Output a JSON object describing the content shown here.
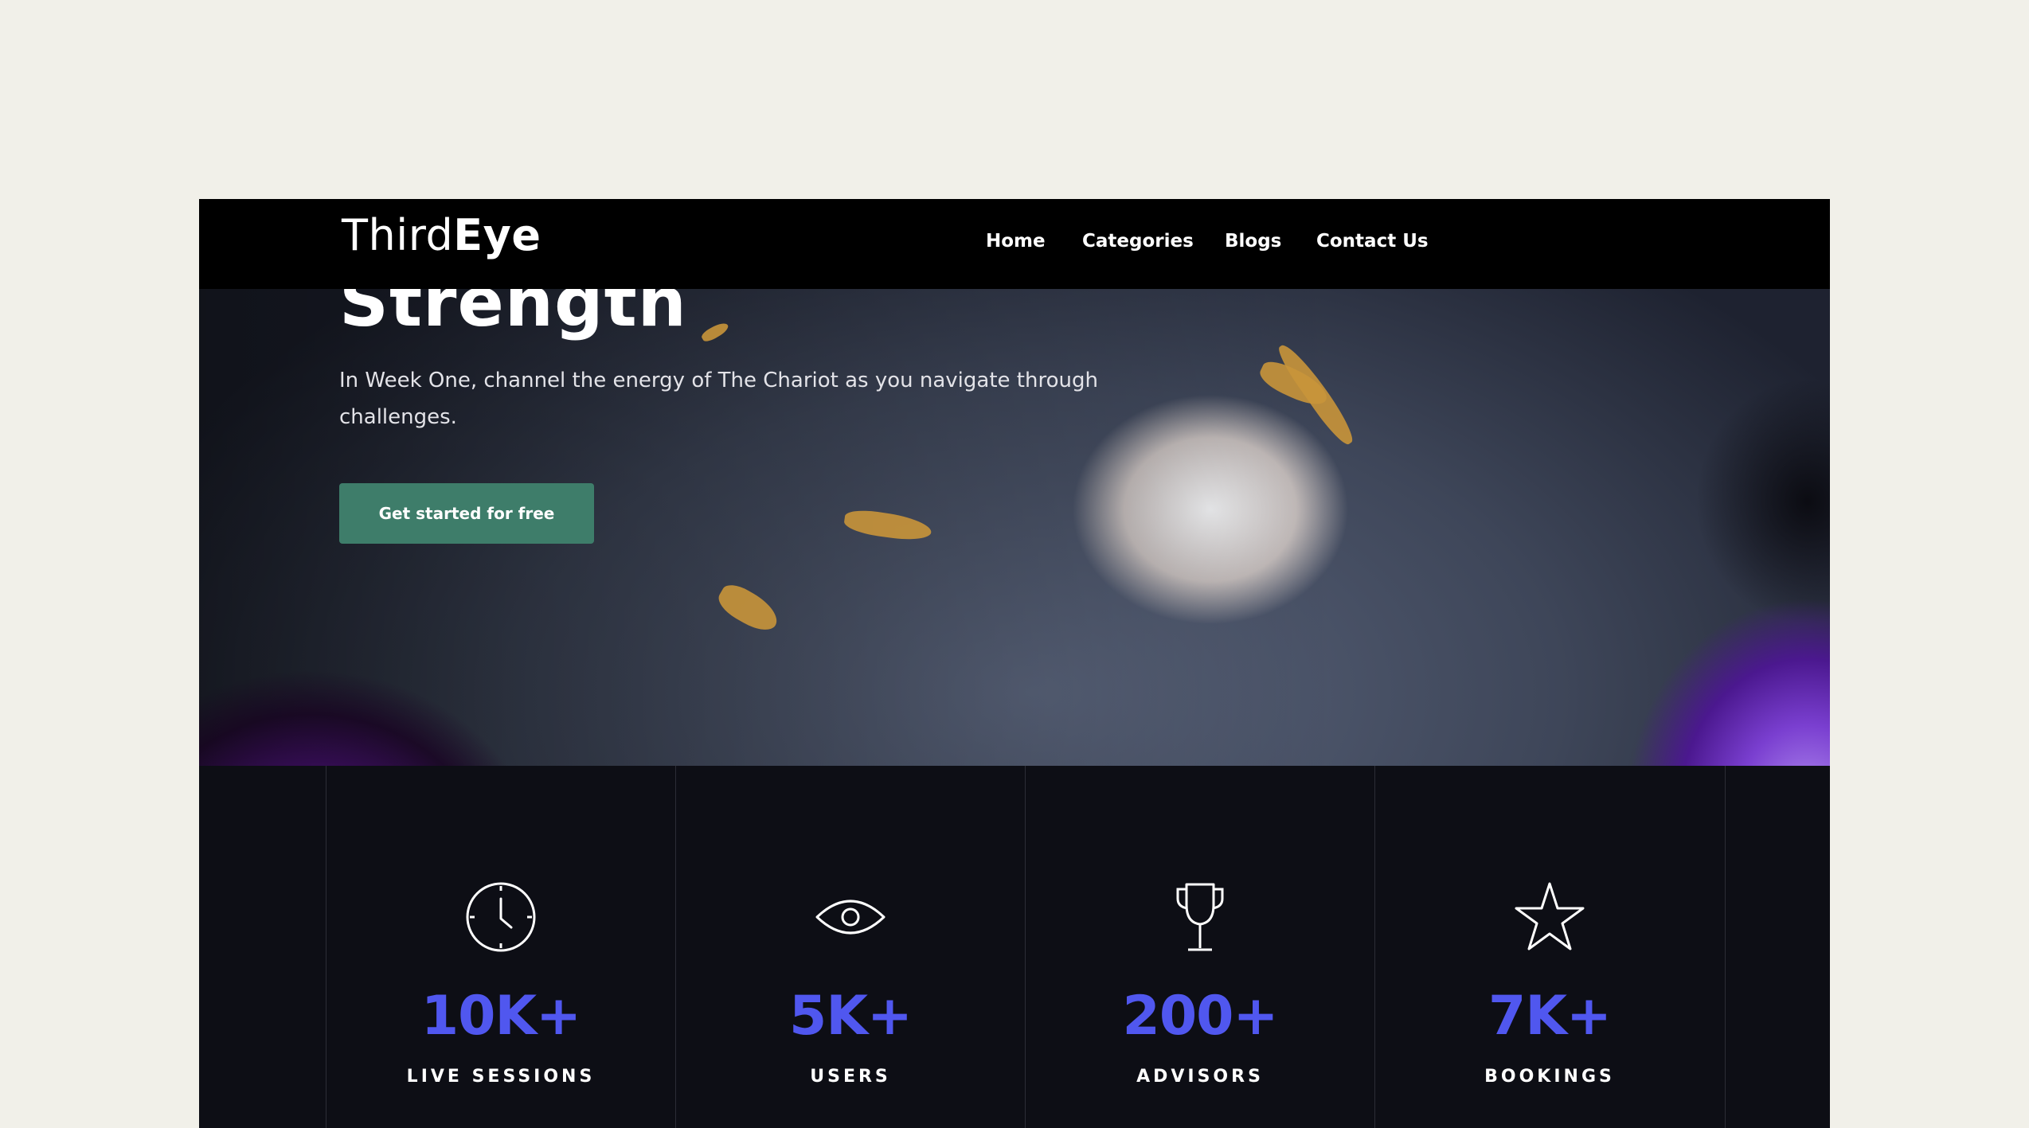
{
  "brand": {
    "logo_regular": "Third",
    "logo_bold": "Eye"
  },
  "nav": {
    "items": [
      {
        "label": "Home"
      },
      {
        "label": "Categories"
      },
      {
        "label": "Blogs"
      },
      {
        "label": "Contact Us"
      }
    ]
  },
  "hero": {
    "title": "Strength",
    "description": "In Week One, channel the energy of The Chariot as you navigate through challenges.",
    "cta_label": "Get started for free",
    "cta_color": "#3e7d6a"
  },
  "stats": {
    "accent_color": "#5057ef",
    "items": [
      {
        "value": "10K+",
        "label": "LIVE SESSIONS",
        "icon": "clock-icon"
      },
      {
        "value": "5K+",
        "label": "USERS",
        "icon": "eye-icon"
      },
      {
        "value": "200+",
        "label": "ADVISORS",
        "icon": "trophy-icon"
      },
      {
        "value": "7K+",
        "label": "BOOKINGS",
        "icon": "star-icon"
      }
    ]
  }
}
